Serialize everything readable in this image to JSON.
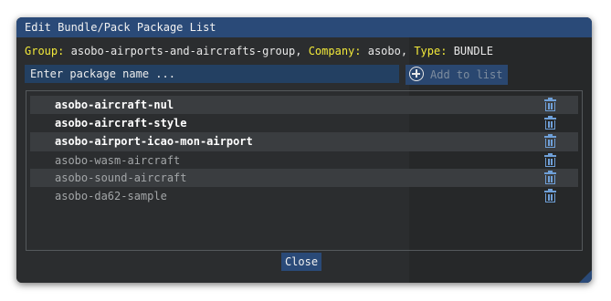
{
  "dialog": {
    "title": "Edit Bundle/Pack Package List"
  },
  "info": {
    "group_label": "Group:",
    "group_value": "asobo-airports-and-aircrafts-group,",
    "company_label": "Company:",
    "company_value": "asobo,",
    "type_label": "Type:",
    "type_value": "BUNDLE"
  },
  "input": {
    "placeholder": "Enter package name ...",
    "value": ""
  },
  "add_button": {
    "label": "Add to list",
    "icon": "plus-circle-icon"
  },
  "packages": [
    {
      "name": "asobo-aircraft-nul",
      "active": true
    },
    {
      "name": "asobo-aircraft-style",
      "active": true
    },
    {
      "name": "asobo-airport-icao-mon-airport",
      "active": true
    },
    {
      "name": "asobo-wasm-aircraft",
      "active": false
    },
    {
      "name": "asobo-sound-aircraft",
      "active": false
    },
    {
      "name": "asobo-da62-sample",
      "active": false
    }
  ],
  "row_action_icon": "trash-icon",
  "close_button": {
    "label": "Close"
  },
  "colors": {
    "title_bar": "#2a4a78",
    "label_yellow": "#f2e93a",
    "trash_blue": "#6fa0d8",
    "dialog_bg": "#2e3133"
  }
}
